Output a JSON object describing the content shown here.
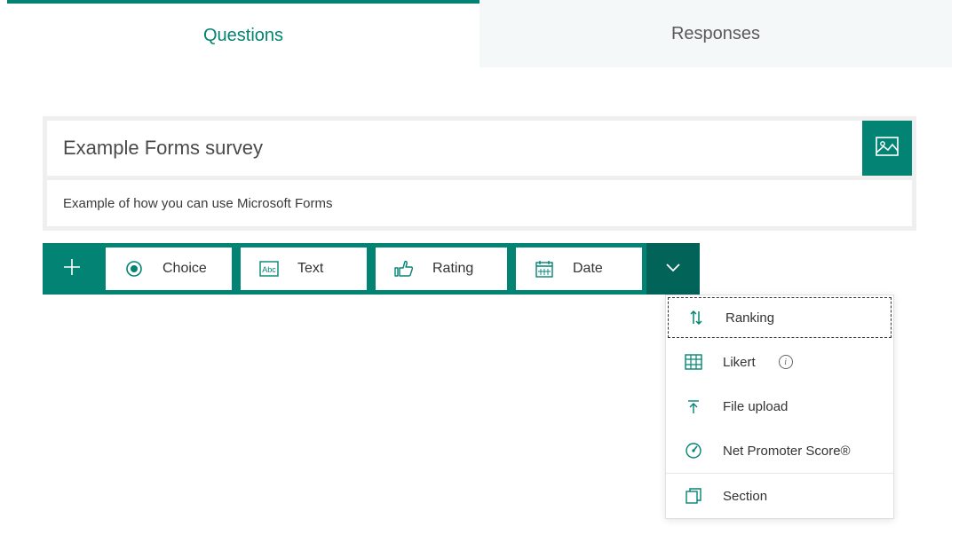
{
  "tabs": {
    "questions": "Questions",
    "responses": "Responses"
  },
  "form": {
    "title": "Example Forms survey",
    "description": "Example of how you can use Microsoft Forms"
  },
  "question_types": {
    "choice": "Choice",
    "text": "Text",
    "rating": "Rating",
    "date": "Date"
  },
  "more_types": {
    "ranking": "Ranking",
    "likert": "Likert",
    "file_upload": "File upload",
    "nps": "Net Promoter Score®",
    "section": "Section"
  },
  "colors": {
    "teal": "#038373",
    "teal_dark": "#026358"
  }
}
